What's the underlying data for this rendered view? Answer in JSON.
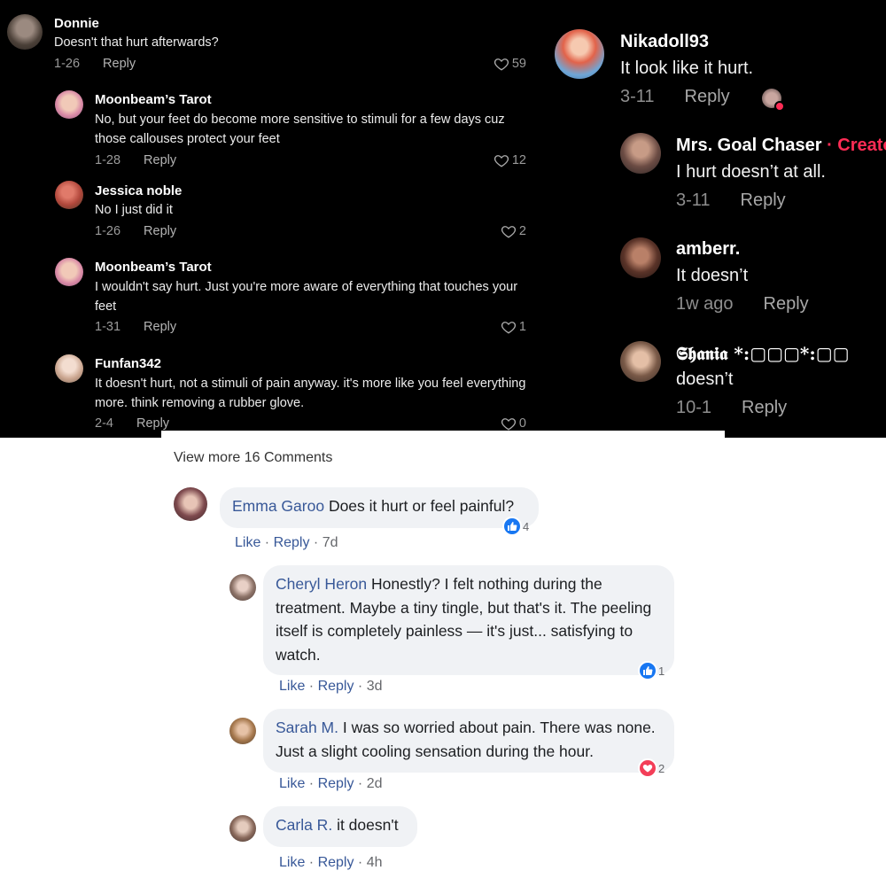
{
  "left_comments": [
    {
      "name": "Donnie",
      "text": "Doesn't that hurt afterwards?",
      "date": "1-26",
      "reply": "Reply",
      "likes": "59"
    },
    {
      "name": "Moonbeam’s Tarot",
      "text": "No, but your feet do become more sensitive to stimuli for a few days cuz those callouses protect your feet",
      "date": "1-28",
      "reply": "Reply",
      "likes": "12"
    },
    {
      "name": "Jessica noble",
      "text": "No I just did it",
      "date": "1-26",
      "reply": "Reply",
      "likes": "2"
    },
    {
      "name": "Moonbeam’s Tarot",
      "text": "I wouldn't say hurt. Just you're more aware of everything that touches your feet",
      "date": "1-31",
      "reply": "Reply",
      "likes": "1"
    },
    {
      "name": "Funfan342",
      "text": "It doesn't hurt, not a stimuli of pain anyway. it's more like you feel everything more. think removing a rubber glove.",
      "date": "2-4",
      "reply": "Reply",
      "likes": "0"
    }
  ],
  "right_comments": [
    {
      "name": "Nikadoll93",
      "text": "It look like it hurt.",
      "date": "3-11",
      "reply": "Reply"
    },
    {
      "name": "Mrs. Goal Chaser",
      "creator_tag": " · Creato",
      "text": "I hurt doesn’t at all.",
      "date": "3-11",
      "reply": "Reply"
    },
    {
      "name": "amberr.",
      "text": "It doesn’t",
      "date": "1w ago",
      "reply": "Reply"
    },
    {
      "name": "𝕾𝖍𝖆𝖓𝖎𝖆 *:▢▢▢*:▢▢",
      "text": "doesn’t",
      "date": "10-1",
      "reply": "Reply"
    }
  ],
  "fb": {
    "view_more": "View more 16 Comments",
    "comments": [
      {
        "author": "Emma Garoo",
        "text": "Does it hurt or feel painful?",
        "like": "Like",
        "reply": "Reply",
        "time": "7d",
        "reaction_count": "4",
        "reaction": "like"
      },
      {
        "author": "Cheryl Heron",
        "text": "Honestly? I felt nothing during the treatment. Maybe a tiny tingle, but that's it. The peeling itself is completely painless — it's just... satisfying to watch.",
        "like": "Like",
        "reply": "Reply",
        "time": "3d",
        "reaction_count": "1",
        "reaction": "like"
      },
      {
        "author": "Sarah M.",
        "text": "I was so worried about pain. There was none. Just a slight cooling sensation during the hour.",
        "like": "Like",
        "reply": "Reply",
        "time": "2d",
        "reaction_count": "2",
        "reaction": "love"
      },
      {
        "author": "Carla R.",
        "text": "it doesn't",
        "like": "Like",
        "reply": "Reply",
        "time": "4h"
      }
    ]
  },
  "colors": {
    "fb_link": "#385898",
    "like_blue": "#1877f2",
    "love_red": "#f33e58",
    "creator_red": "#fe2c55",
    "bubble_bg": "#f0f2f5"
  }
}
